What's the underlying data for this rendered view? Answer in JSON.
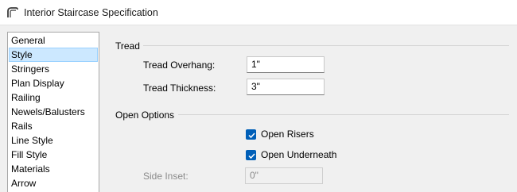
{
  "window": {
    "title": "Interior Staircase Specification"
  },
  "sidebar": {
    "items": [
      {
        "label": "General"
      },
      {
        "label": "Style"
      },
      {
        "label": "Stringers"
      },
      {
        "label": "Plan Display"
      },
      {
        "label": "Railing"
      },
      {
        "label": "Newels/Balusters"
      },
      {
        "label": "Rails"
      },
      {
        "label": "Line Style"
      },
      {
        "label": "Fill Style"
      },
      {
        "label": "Materials"
      },
      {
        "label": "Arrow"
      }
    ],
    "selected": "Style"
  },
  "tread": {
    "heading": "Tread",
    "overhang_label": "Tread Overhang:",
    "overhang_value": "1\"",
    "thickness_label": "Tread Thickness:",
    "thickness_value": "3\""
  },
  "open_options": {
    "heading": "Open Options",
    "open_risers_label": "Open Risers",
    "open_risers_checked": true,
    "open_underneath_label": "Open Underneath",
    "open_underneath_checked": true,
    "side_inset_label": "Side Inset:",
    "side_inset_value": "0\""
  },
  "colors": {
    "accent": "#005fb8",
    "selection": "#cce8ff"
  }
}
